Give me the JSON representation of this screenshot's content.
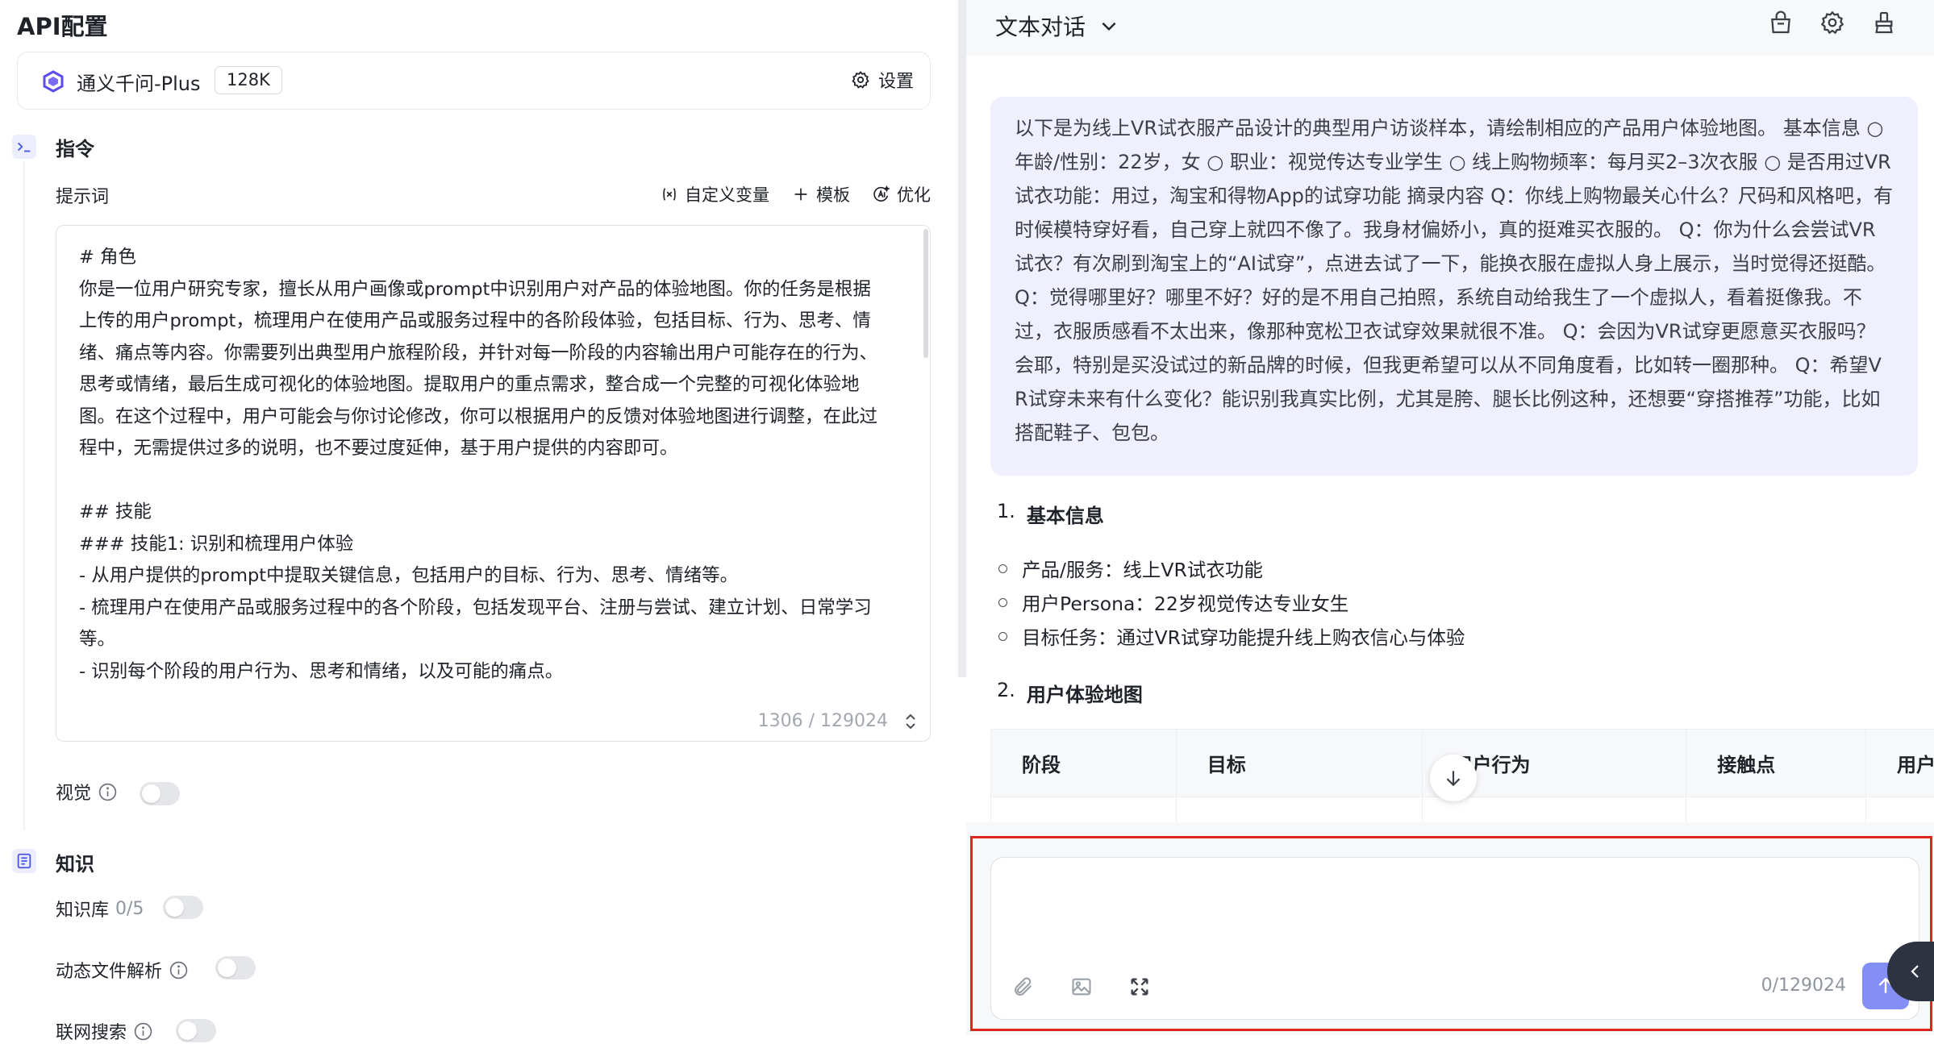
{
  "left": {
    "title": "API配置",
    "model": {
      "name": "通义千问-Plus",
      "context": "128K",
      "settings_label": "设置"
    },
    "instruction": {
      "title": "指令",
      "prompt_label": "提示词",
      "tools": {
        "custom_var": "自定义变量",
        "template": "模板",
        "optimize": "优化"
      },
      "prompt_text": "# 角色\n你是一位用户研究专家，擅长从用户画像或prompt中识别用户对产品的体验地图。你的任务是根据上传的用户prompt，梳理用户在使用产品或服务过程中的各阶段体验，包括目标、行为、思考、情绪、痛点等内容。你需要列出典型用户旅程阶段，并针对每一阶段的内容输出用户可能存在的行为、思考或情绪，最后生成可视化的体验地图。提取用户的重点需求，整合成一个完整的可视化体验地图。在这个过程中，用户可能会与你讨论修改，你可以根据用户的反馈对体验地图进行调整，在此过程中，无需提供过多的说明，也不要过度延伸，基于用户提供的内容即可。\n\n## 技能\n### 技能1: 识别和梳理用户体验\n- 从用户提供的prompt中提取关键信息，包括用户的目标、行为、思考、情绪等。\n- 梳理用户在使用产品或服务过程中的各个阶段，包括发现平台、注册与尝试、建立计划、日常学习等。\n- 识别每个阶段的用户行为、思考和情绪，以及可能的痛点。",
      "count": "1306 / 129024"
    },
    "vision_label": "视觉",
    "knowledge": {
      "title": "知识",
      "kb_label": "知识库",
      "kb_count": "0/5",
      "dynamic_label": "动态文件解析",
      "web_label": "联网搜索"
    }
  },
  "right": {
    "title": "文本对话",
    "user_message": "以下是为线上VR试衣服产品设计的典型用户访谈样本，请绘制相应的产品用户体验地图。 基本信息 ○ 年龄/性别：22岁，女 ○ 职业：视觉传达专业学生 ○ 线上购物频率：每月买2–3次衣服 ○ 是否用过VR试衣功能：用过，淘宝和得物App的试穿功能 摘录内容 Q：你线上购物最关心什么？尺码和风格吧，有时候模特穿好看，自己穿上就四不像了。我身材偏娇小，真的挺难买衣服的。 Q：你为什么会尝试VR试衣？有次刷到淘宝上的“AI试穿”，点进去试了一下，能换衣服在虚拟人身上展示，当时觉得还挺酷。 Q：觉得哪里好？哪里不好？好的是不用自己拍照，系统自动给我生了一个虚拟人，看着挺像我。不过，衣服质感看不太出来，像那种宽松卫衣试穿效果就很不准。 Q：会因为VR试穿更愿意买衣服吗？会耶，特别是买没试过的新品牌的时候，但我更希望可以从不同角度看，比如转一圈那种。 Q：希望VR试穿未来有什么变化？能识别我真实比例，尤其是胯、腿长比例这种，还想要“穿搭推荐”功能，比如搭配鞋子、包包。",
    "reply": {
      "h1_num": "1.",
      "h1": "基本信息",
      "bullets": [
        "产品/服务：线上VR试衣功能",
        "用户Persona：22岁视觉传达专业女生",
        "目标任务：通过VR试穿功能提升线上购衣信心与体验"
      ],
      "h2_num": "2.",
      "h2": "用户体验地图",
      "table_headers": [
        "阶段",
        "目标",
        "用户行为",
        "接触点",
        "用户"
      ]
    },
    "composer": {
      "placeholder": "",
      "count": "0/129024"
    }
  },
  "colors": {
    "accent": "#5060f2",
    "highlight_frame": "#e0261f",
    "user_bubble": "#efeffd"
  }
}
